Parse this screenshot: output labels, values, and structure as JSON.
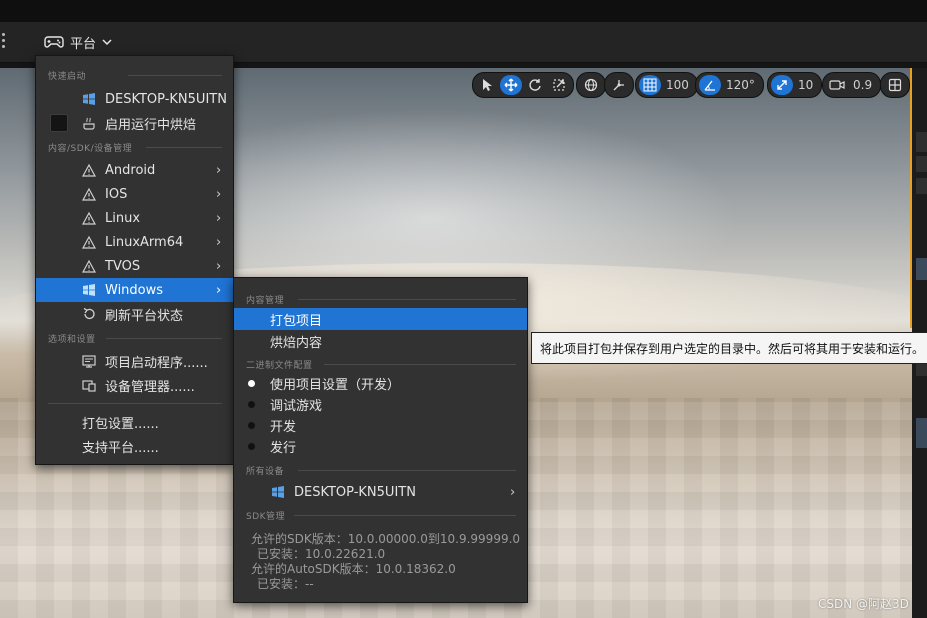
{
  "toolbar": {
    "platform_label": "平台"
  },
  "viewport_toolbar": {
    "grid_value": "100",
    "angle_value": "120°",
    "scale_value": "10",
    "camera_speed": "0.9"
  },
  "main_menu": {
    "section_quick_launch": "快速启动",
    "device_desktop": "DESKTOP-KN5UITN",
    "enable_cook_on_the_fly": "启用运行中烘焙",
    "section_content_sdk": "内容/SDK/设备管理",
    "platforms": [
      "Android",
      "IOS",
      "Linux",
      "LinuxArm64",
      "TVOS",
      "Windows"
    ],
    "refresh_platform_status": "刷新平台状态",
    "section_options": "选项和设置",
    "project_launcher": "项目启动程序......",
    "device_manager": "设备管理器......",
    "packaging_settings": "打包设置......",
    "supported_platforms": "支持平台......"
  },
  "submenu": {
    "section_content": "内容管理",
    "package_project": "打包项目",
    "cook_content": "烘焙内容",
    "section_binary": "二进制文件配置",
    "binary_options": [
      "使用项目设置（开发）",
      "调试游戏",
      "开发",
      "发行"
    ],
    "section_all_devices": "所有设备",
    "device_desktop": "DESKTOP-KN5UITN",
    "section_sdk": "SDK管理",
    "sdk_allowed": "允许的SDK版本：10.0.00000.0到10.9.99999.0",
    "sdk_installed": "已安装：10.0.22621.0",
    "autosdk_allowed": "允许的AutoSDK版本：10.0.18362.0",
    "autosdk_installed": "已安装：--"
  },
  "tooltip": "将此项目打包并保存到用户选定的目录中。然后可将其用于安装和运行。",
  "watermark": "CSDN @阿赵3D",
  "colors": {
    "accent": "#1f74d4",
    "menu_bg": "#323232",
    "highlight_border": "#e8a020"
  }
}
